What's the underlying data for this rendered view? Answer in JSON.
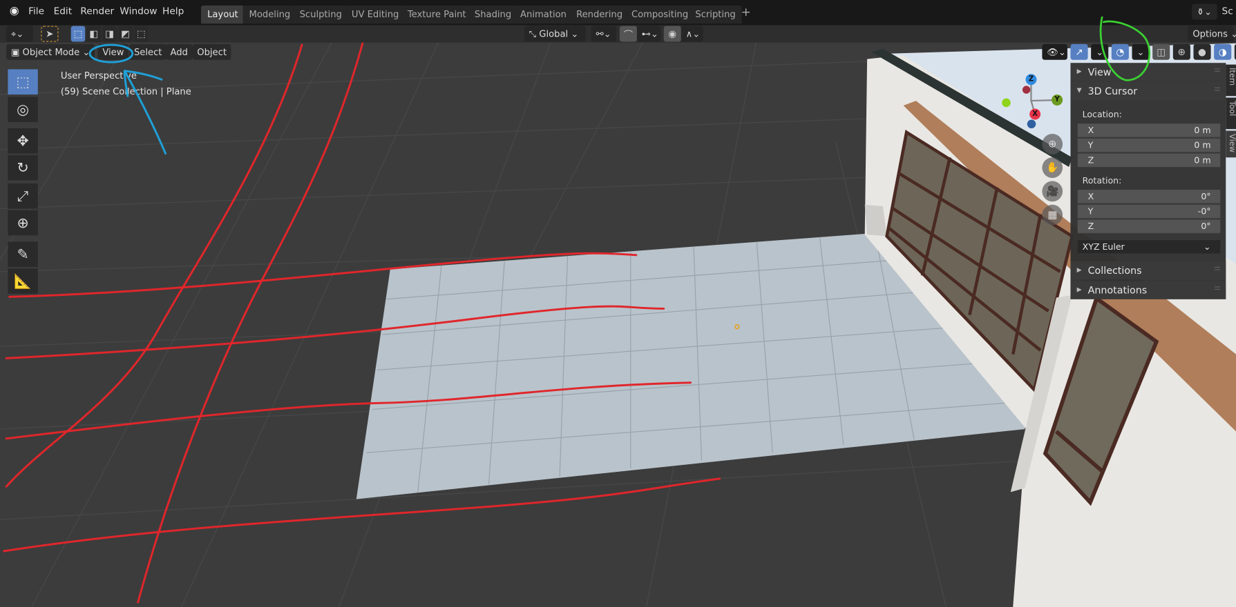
{
  "menubar": {
    "items": [
      "File",
      "Edit",
      "Render",
      "Window",
      "Help"
    ]
  },
  "workspaces": {
    "tabs": [
      "Layout",
      "Modeling",
      "Sculpting",
      "UV Editing",
      "Texture Paint",
      "Shading",
      "Animation",
      "Rendering",
      "Compositing",
      "Scripting"
    ],
    "active": "Layout",
    "add": "+",
    "scene": "Sc"
  },
  "toolheader": {
    "orientation": "Global",
    "options": "Options"
  },
  "viewheader": {
    "mode": "Object Mode",
    "menus": [
      "View",
      "Select",
      "Add",
      "Object"
    ]
  },
  "viewport": {
    "perspective": "User Perspective",
    "collection": "(59) Scene Collection | Plane"
  },
  "gizmo": {
    "x": "X",
    "y": "Y",
    "z": "Z"
  },
  "sidebar": {
    "sections": {
      "view": "View",
      "cursor": "3D Cursor",
      "collections": "Collections",
      "annotations": "Annotations"
    },
    "location_label": "Location:",
    "location": [
      {
        "axis": "X",
        "value": "0 m"
      },
      {
        "axis": "Y",
        "value": "0 m"
      },
      {
        "axis": "Z",
        "value": "0 m"
      }
    ],
    "rotation_label": "Rotation:",
    "rotation": [
      {
        "axis": "X",
        "value": "0°"
      },
      {
        "axis": "Y",
        "value": "-0°"
      },
      {
        "axis": "Z",
        "value": "0°"
      }
    ],
    "rotation_mode": "XYZ Euler",
    "tabs": [
      "Item",
      "Tool",
      "View"
    ]
  },
  "colors": {
    "accent": "#5680c2",
    "annotation_red": "#e0262b",
    "annotation_blue": "#1fa0d8",
    "annotation_green": "#3bd132"
  }
}
